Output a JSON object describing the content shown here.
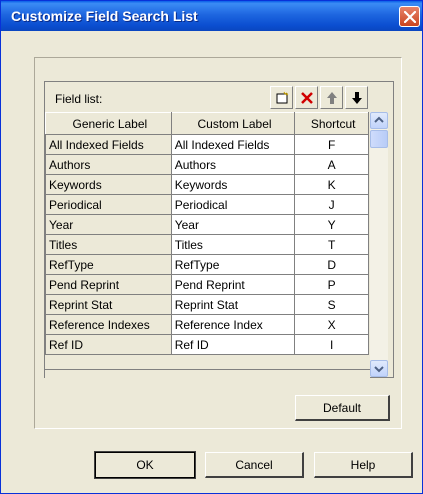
{
  "window": {
    "title": "Customize Field Search List"
  },
  "field_list": {
    "label": "Field list:",
    "toolbar": [
      {
        "name": "new-field-button",
        "icon": "new-item-icon"
      },
      {
        "name": "delete-field-button",
        "icon": "delete-x-icon"
      },
      {
        "name": "move-up-button",
        "icon": "arrow-up-icon"
      },
      {
        "name": "move-down-button",
        "icon": "arrow-down-icon"
      }
    ],
    "columns": [
      "Generic Label",
      "Custom Label",
      "Shortcut"
    ],
    "rows": [
      {
        "generic": "All Indexed Fields",
        "custom": "All Indexed Fields",
        "shortcut": "F"
      },
      {
        "generic": "Authors",
        "custom": "Authors",
        "shortcut": "A"
      },
      {
        "generic": "Keywords",
        "custom": "Keywords",
        "shortcut": "K"
      },
      {
        "generic": "Periodical",
        "custom": "Periodical",
        "shortcut": "J"
      },
      {
        "generic": "Year",
        "custom": "Year",
        "shortcut": "Y"
      },
      {
        "generic": "Titles",
        "custom": "Titles",
        "shortcut": "T"
      },
      {
        "generic": "RefType",
        "custom": "RefType",
        "shortcut": "D"
      },
      {
        "generic": "Pend Reprint",
        "custom": "Pend Reprint",
        "shortcut": "P"
      },
      {
        "generic": "Reprint Stat",
        "custom": "Reprint Stat",
        "shortcut": "S"
      },
      {
        "generic": "Reference Indexes",
        "custom": "Reference Index",
        "shortcut": "X"
      },
      {
        "generic": "Ref ID",
        "custom": "Ref ID",
        "shortcut": "I"
      }
    ]
  },
  "buttons": {
    "default": "Default",
    "ok": "OK",
    "cancel": "Cancel",
    "help": "Help"
  }
}
